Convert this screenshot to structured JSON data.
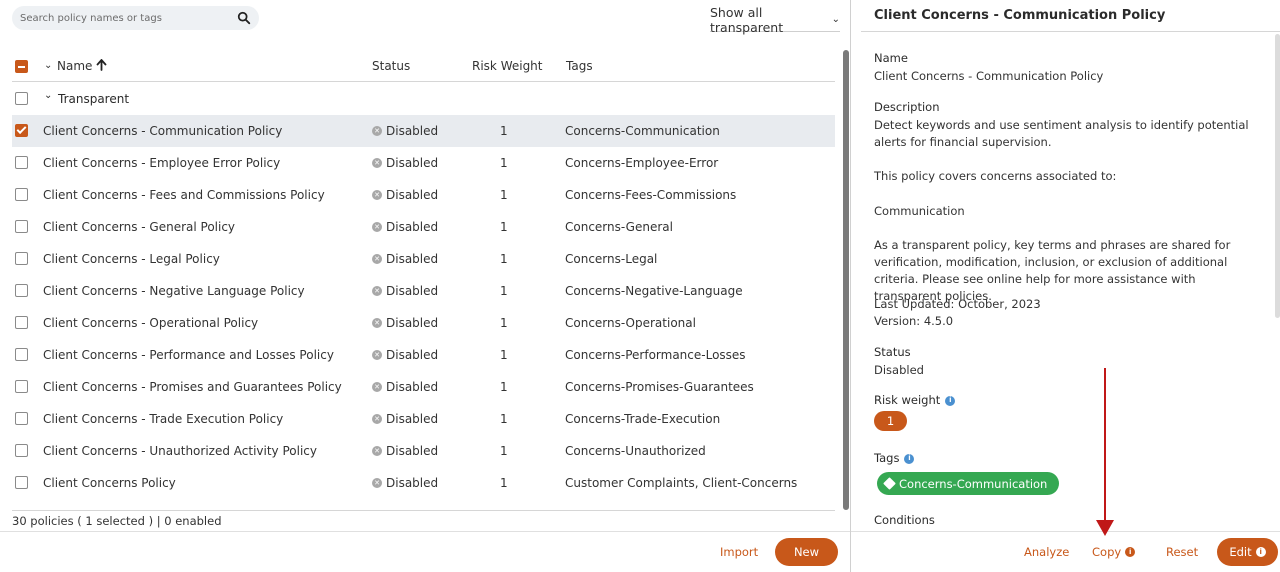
{
  "search": {
    "placeholder": "Search policy names or tags"
  },
  "filter": {
    "label": "Show all transparent"
  },
  "columns": {
    "name": "Name",
    "status": "Status",
    "risk_weight": "Risk Weight",
    "tags": "Tags"
  },
  "group": {
    "label": "Transparent"
  },
  "rows": [
    {
      "name": "Client Concerns - Communication Policy",
      "status": "Disabled",
      "weight": "1",
      "tags": "Concerns-Communication",
      "selected": true
    },
    {
      "name": "Client Concerns - Employee Error Policy",
      "status": "Disabled",
      "weight": "1",
      "tags": "Concerns-Employee-Error"
    },
    {
      "name": "Client Concerns - Fees and Commissions Policy",
      "status": "Disabled",
      "weight": "1",
      "tags": "Concerns-Fees-Commissions"
    },
    {
      "name": "Client Concerns - General Policy",
      "status": "Disabled",
      "weight": "1",
      "tags": "Concerns-General"
    },
    {
      "name": "Client Concerns - Legal Policy",
      "status": "Disabled",
      "weight": "1",
      "tags": "Concerns-Legal"
    },
    {
      "name": "Client Concerns - Negative Language Policy",
      "status": "Disabled",
      "weight": "1",
      "tags": "Concerns-Negative-Language"
    },
    {
      "name": "Client Concerns - Operational Policy",
      "status": "Disabled",
      "weight": "1",
      "tags": "Concerns-Operational"
    },
    {
      "name": "Client Concerns - Performance and Losses Policy",
      "status": "Disabled",
      "weight": "1",
      "tags": "Concerns-Performance-Losses"
    },
    {
      "name": "Client Concerns - Promises and Guarantees Policy",
      "status": "Disabled",
      "weight": "1",
      "tags": "Concerns-Promises-Guarantees"
    },
    {
      "name": "Client Concerns - Trade Execution Policy",
      "status": "Disabled",
      "weight": "1",
      "tags": "Concerns-Trade-Execution"
    },
    {
      "name": "Client Concerns - Unauthorized Activity Policy",
      "status": "Disabled",
      "weight": "1",
      "tags": "Concerns-Unauthorized"
    },
    {
      "name": "Client Concerns Policy",
      "status": "Disabled",
      "weight": "1",
      "tags": "Customer Complaints, Client-Concerns"
    }
  ],
  "footer": {
    "summary": "30 policies ( 1 selected ) | 0 enabled"
  },
  "left_actions": {
    "import": "Import",
    "new": "New"
  },
  "detail": {
    "title": "Client Concerns - Communication Policy",
    "name_label": "Name",
    "name_value": "Client Concerns - Communication Policy",
    "description_label": "Description",
    "description_p1": "Detect keywords and use sentiment analysis to identify potential alerts for financial supervision.",
    "description_p2": "This policy covers concerns associated to:",
    "description_p3": "Communication",
    "description_p4": "As a transparent policy, key terms and phrases are shared for verification, modification, inclusion, or exclusion of additional criteria. Please see online help for more assistance with transparent policies.",
    "last_updated": "Last Updated: October, 2023",
    "version": "Version: 4.5.0",
    "status_label": "Status",
    "status_value": "Disabled",
    "risk_weight_label": "Risk weight",
    "risk_weight_value": "1",
    "tags_label": "Tags",
    "tag_value": "Concerns-Communication",
    "conditions_label": "Conditions"
  },
  "right_actions": {
    "analyze": "Analyze",
    "copy": "Copy",
    "reset": "Reset",
    "edit": "Edit"
  },
  "colors": {
    "accent": "#c8581a",
    "tag_green": "#35a852",
    "info_blue": "#4a90d0",
    "annotation_red": "#c01818"
  }
}
